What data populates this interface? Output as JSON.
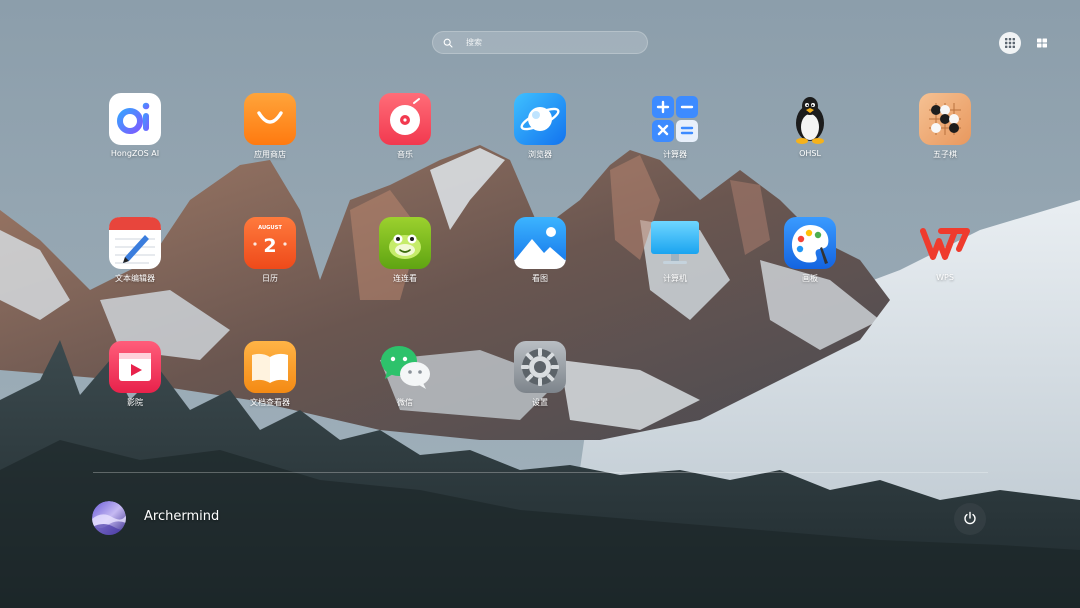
{
  "search": {
    "placeholder": "搜索",
    "icon": "search-icon"
  },
  "view_toggles": [
    {
      "icon": "grid-view-icon",
      "active": true
    },
    {
      "icon": "layout-view-icon",
      "active": false
    }
  ],
  "apps": [
    {
      "label": "HongZOS AI",
      "icon": "hongzos-ai-icon"
    },
    {
      "label": "应用商店",
      "icon": "shopping-bag-icon"
    },
    {
      "label": "音乐",
      "icon": "music-disc-icon"
    },
    {
      "label": "浏览器",
      "icon": "planet-icon"
    },
    {
      "label": "计算器",
      "icon": "calculator-icon"
    },
    {
      "label": "OHSL",
      "icon": "penguin-icon"
    },
    {
      "label": "五子棋",
      "icon": "gomoku-board-icon"
    },
    {
      "label": "文本编辑器",
      "icon": "notepad-pencil-icon"
    },
    {
      "label": "日历",
      "icon": "calendar-icon",
      "calendar_month": "AUGUST",
      "calendar_day": "2"
    },
    {
      "label": "连连看",
      "icon": "link-game-icon"
    },
    {
      "label": "看图",
      "icon": "photo-icon"
    },
    {
      "label": "计算机",
      "icon": "monitor-icon"
    },
    {
      "label": "画板",
      "icon": "palette-icon"
    },
    {
      "label": "WPS",
      "icon": "wps-icon"
    },
    {
      "label": "影院",
      "icon": "clapperboard-icon"
    },
    {
      "label": "文档查看器",
      "icon": "open-book-icon"
    },
    {
      "label": "微信",
      "icon": "wechat-icon"
    },
    {
      "label": "设置",
      "icon": "gear-icon"
    }
  ],
  "user": {
    "name": "Archermind",
    "avatar": "avatar-icon"
  },
  "power": {
    "icon": "power-icon"
  },
  "colors": {
    "sky": "#8fa1ad",
    "accent_orange": "#ff8a1f",
    "accent_blue": "#1e88f5",
    "text": "#ffffff"
  }
}
